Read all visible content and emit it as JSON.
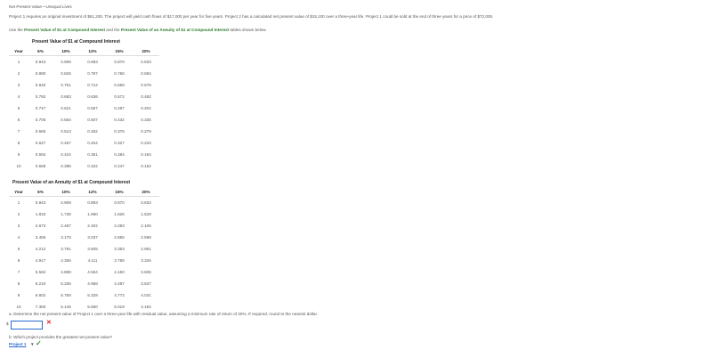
{
  "title": "Net Present Value—Unequal Lives",
  "problem": {
    "p1": "Project 1 requires an original investment of $61,200. The project will yield cash flows of $17,000 per year for five years. Project 2 has a calculated net present value of $15,100 over a three-year life. Project 1 could be sold at the end of three years for a price of $72,000.",
    "p2_pre": "Use the",
    "p2_link1": "Present Value of $1 at Compound Interest",
    "p2_mid": "and the",
    "p2_link2": "Present Value of an Annuity of $1 at Compound Interest",
    "p2_post": "tables shown below."
  },
  "table1": {
    "caption": "Present Value of $1 at Compound Interest",
    "headers": [
      "Year",
      "6%",
      "10%",
      "12%",
      "15%",
      "20%"
    ],
    "rows": [
      [
        "1",
        "0.943",
        "0.909",
        "0.893",
        "0.870",
        "0.833"
      ],
      [
        "2",
        "0.890",
        "0.826",
        "0.797",
        "0.756",
        "0.694"
      ],
      [
        "3",
        "0.840",
        "0.751",
        "0.712",
        "0.658",
        "0.579"
      ],
      [
        "4",
        "0.792",
        "0.683",
        "0.636",
        "0.572",
        "0.482"
      ],
      [
        "5",
        "0.747",
        "0.621",
        "0.567",
        "0.497",
        "0.402"
      ],
      [
        "6",
        "0.705",
        "0.564",
        "0.507",
        "0.432",
        "0.335"
      ],
      [
        "7",
        "0.665",
        "0.513",
        "0.452",
        "0.376",
        "0.279"
      ],
      [
        "8",
        "0.627",
        "0.467",
        "0.404",
        "0.327",
        "0.233"
      ],
      [
        "9",
        "0.592",
        "0.424",
        "0.361",
        "0.284",
        "0.194"
      ],
      [
        "10",
        "0.558",
        "0.386",
        "0.322",
        "0.247",
        "0.162"
      ]
    ]
  },
  "table2": {
    "caption": "Present Value of an Annuity of $1 at Compound Interest",
    "headers": [
      "Year",
      "6%",
      "10%",
      "12%",
      "15%",
      "20%"
    ],
    "rows": [
      [
        "1",
        "0.943",
        "0.909",
        "0.893",
        "0.870",
        "0.833"
      ],
      [
        "2",
        "1.833",
        "1.736",
        "1.690",
        "1.626",
        "1.528"
      ],
      [
        "3",
        "2.673",
        "2.487",
        "2.402",
        "2.283",
        "2.106"
      ],
      [
        "4",
        "3.465",
        "3.170",
        "3.037",
        "2.855",
        "2.589"
      ],
      [
        "5",
        "4.212",
        "3.791",
        "3.605",
        "3.353",
        "2.991"
      ],
      [
        "6",
        "4.917",
        "4.355",
        "4.111",
        "3.785",
        "3.326"
      ],
      [
        "7",
        "5.582",
        "4.868",
        "4.564",
        "4.160",
        "3.605"
      ],
      [
        "8",
        "6.210",
        "5.335",
        "4.968",
        "4.487",
        "3.837"
      ],
      [
        "9",
        "6.802",
        "5.759",
        "5.328",
        "4.772",
        "4.031"
      ],
      [
        "10",
        "7.360",
        "6.145",
        "5.650",
        "5.019",
        "4.192"
      ]
    ]
  },
  "question_a": "a. Determine the net present value of Project 1 over a three-year life with residual value, assuming a minimum rate of return of 20%. If required, round to the nearest dollar.",
  "answer_a": {
    "currency": "$",
    "value": "",
    "status_icon": "x-icon",
    "mark": "✕"
  },
  "question_b": "b. Which project provides the greatest net present value?",
  "answer_b": {
    "selected": "Project 1",
    "caret": "▼",
    "status_icon": "check-icon",
    "mark": "✓"
  }
}
